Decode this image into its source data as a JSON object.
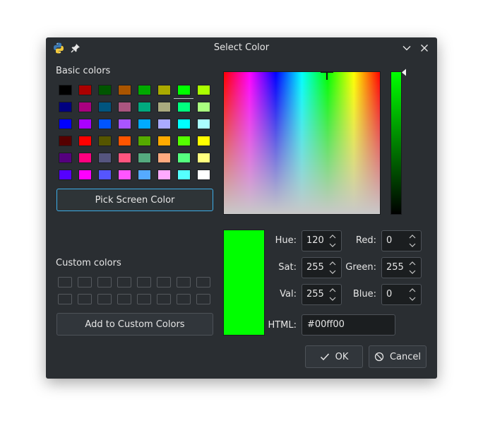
{
  "window": {
    "title": "Select Color",
    "app_icon": "python-logo-icon",
    "pin_icon": "pin-icon",
    "minimize_icon": "chevron-down-icon",
    "close_icon": "close-icon"
  },
  "basic": {
    "label": "Basic colors",
    "colors": [
      "#000000",
      "#aa0000",
      "#005500",
      "#aa5500",
      "#00aa00",
      "#aaaa00",
      "#00ff00",
      "#aaff00",
      "#000080",
      "#aa007f",
      "#00557f",
      "#aa557f",
      "#00aa7f",
      "#aaaa7f",
      "#00ff7f",
      "#aaff7f",
      "#0000ff",
      "#aa00ff",
      "#0055ff",
      "#aa55ff",
      "#00aaff",
      "#aaaaff",
      "#00ffff",
      "#aaffff",
      "#550000",
      "#ff0000",
      "#555500",
      "#ff5500",
      "#55aa00",
      "#ffaa00",
      "#55ff00",
      "#ffff00",
      "#55007f",
      "#ff007f",
      "#55557f",
      "#ff557f",
      "#55aa7f",
      "#ffaa7f",
      "#55ff7f",
      "#ffff7f",
      "#5500ff",
      "#ff00ff",
      "#5555ff",
      "#ff55ff",
      "#55aaff",
      "#ffaaff",
      "#55ffff",
      "#ffffff"
    ],
    "selected_index": 6
  },
  "pick_screen_label": "Pick Screen Color",
  "custom": {
    "label": "Custom colors",
    "count": 16,
    "add_label": "Add to Custom Colors"
  },
  "current_color": "#00ff00",
  "fields": {
    "hue": {
      "label": "Hue:",
      "value": "120"
    },
    "sat": {
      "label": "Sat:",
      "value": "255"
    },
    "val": {
      "label": "Val:",
      "value": "255"
    },
    "red": {
      "label": "Red:",
      "value": "0"
    },
    "green": {
      "label": "Green:",
      "value": "255"
    },
    "blue": {
      "label": "Blue:",
      "value": "0"
    },
    "html": {
      "label": "HTML:",
      "value": "#00ff00"
    }
  },
  "buttons": {
    "ok": "OK",
    "ok_icon": "checkmark-icon",
    "cancel": "Cancel",
    "cancel_icon": "cancel-icon"
  },
  "accent": "#3daee9"
}
